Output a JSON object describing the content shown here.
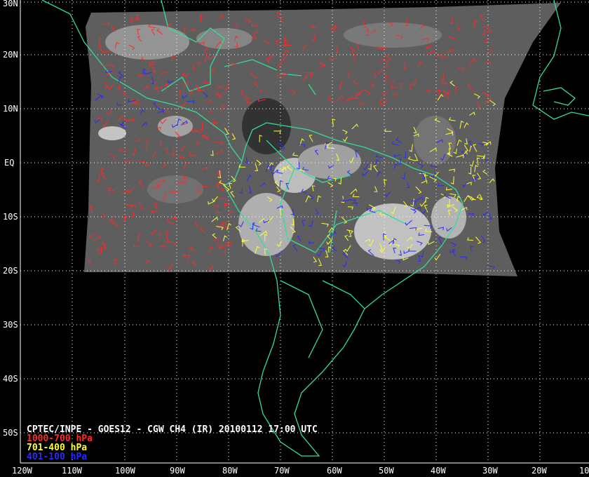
{
  "credit": "CPTEC/INPE - GOES12 - CGW CH4 (IR) 20100112 17:00 UTC",
  "legend": [
    {
      "label": "1000-700 hPa",
      "color": "#ff2a2a"
    },
    {
      "label": "701-400 hPa",
      "color": "#ffff33"
    },
    {
      "label": "401-100 hPa",
      "color": "#2a2aff"
    }
  ],
  "lat_labels": [
    "30N",
    "20N",
    "10N",
    "EQ",
    "10S",
    "20S",
    "30S",
    "40S",
    "50S"
  ],
  "lon_labels": [
    "120W",
    "110W",
    "100W",
    "90W",
    "80W",
    "70W",
    "60W",
    "50W",
    "40W",
    "30W",
    "20W",
    "10"
  ],
  "colors": {
    "background": "#000000",
    "grid": "#ffffff",
    "coastline": "#33dd99",
    "satellite_area": "#6a6a6a"
  }
}
